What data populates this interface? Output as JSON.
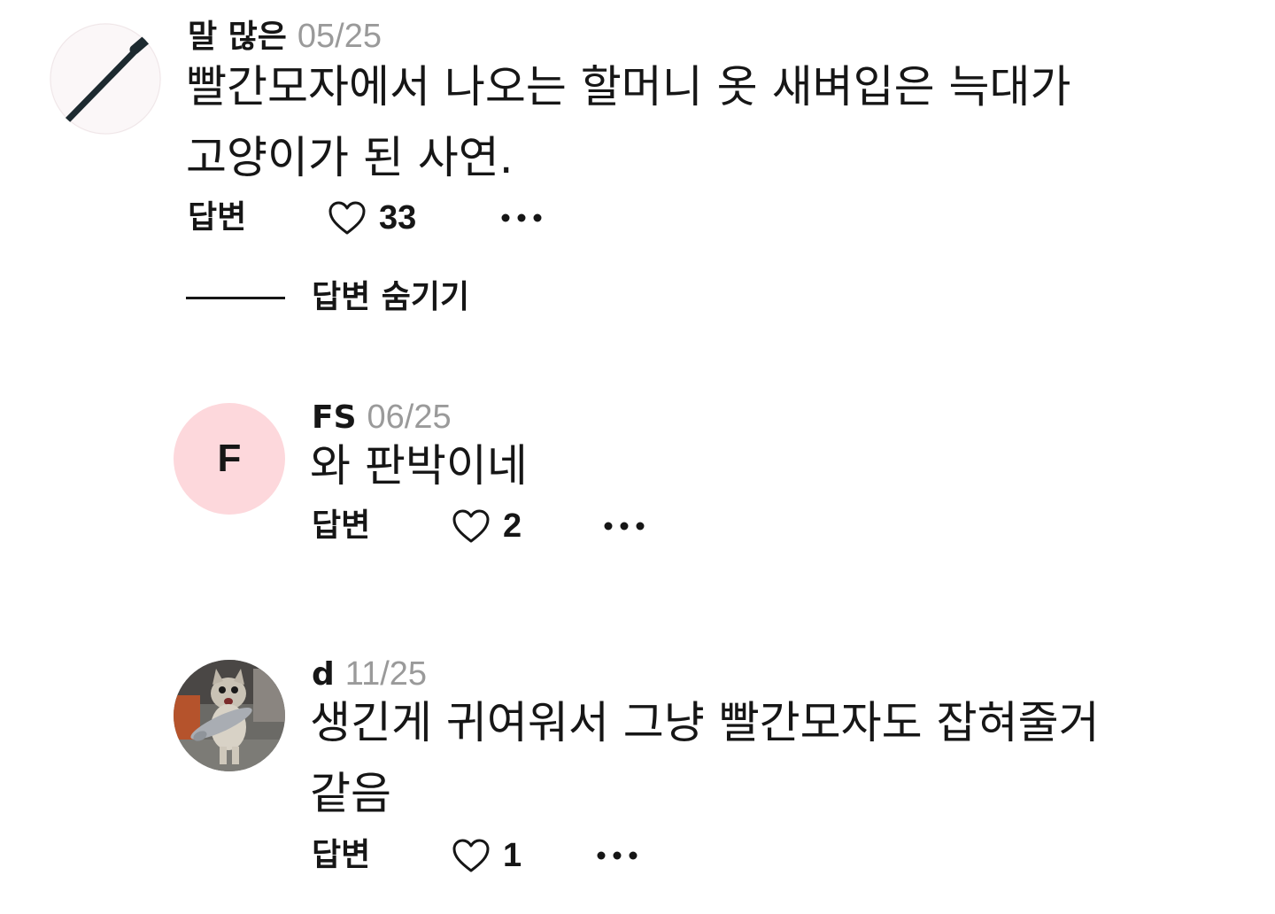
{
  "comments": [
    {
      "author": "말 많은",
      "date": "05/25",
      "text_lines": [
        "빨간모자에서 나오는 할머니 옷 새벼입은 늑대가",
        "고양이가 된 사연."
      ],
      "avatar_icon": "knife-icon",
      "reply_label": "답변",
      "likes": "33"
    },
    {
      "author": "FS",
      "date": "06/25",
      "text_lines": [
        "와 판박이네"
      ],
      "avatar_letter": "F",
      "avatar_color": "#fdd8dc",
      "reply_label": "답변",
      "likes": "2"
    },
    {
      "author": "d",
      "date": "11/25",
      "text_lines": [
        "생긴게 귀여워서 그냥 빨간모자도 잡혀줄거",
        "같음"
      ],
      "avatar_icon": "cat-photo-icon",
      "reply_label": "답변",
      "likes": "1"
    }
  ],
  "hide_replies_label": "답변 숨기기",
  "icons": {
    "like": "heart-outline-icon",
    "more": "more-dots-icon"
  }
}
